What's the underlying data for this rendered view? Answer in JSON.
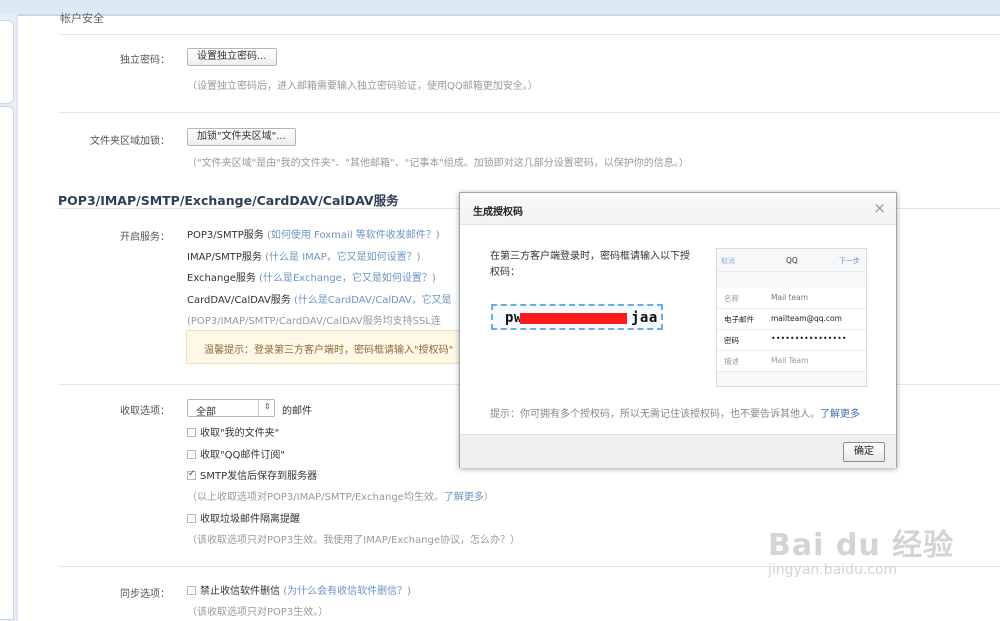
{
  "page": {
    "partial_heading": "帐户安全"
  },
  "independent_password": {
    "label": "独立密码：",
    "button": "设置独立密码...",
    "note": "（设置独立密码后，进入邮箱需要输入独立密码验证，使用QQ邮箱更加安全。）"
  },
  "folder_lock": {
    "label": "文件夹区域加锁：",
    "button": "加锁\"文件夹区域\"...",
    "note": "（\"文件夹区域\"是由\"我的文件夹\"、\"其他邮箱\"、\"记事本\"组成。加锁即对这几部分设置密码，以保护你的信息。）"
  },
  "services": {
    "section_title": "POP3/IMAP/SMTP/Exchange/CardDAV/CalDAV服务",
    "label": "开启服务：",
    "rows": [
      {
        "name": "POP3/SMTP服务",
        "link": "(如何使用 Foxmail 等软件收发邮件？)"
      },
      {
        "name": "IMAP/SMTP服务",
        "link": "(什么是 IMAP，它又是如何设置？)"
      },
      {
        "name": "Exchange服务",
        "link": "(什么是Exchange，它又是如何设置？)"
      },
      {
        "name": "CardDAV/CalDAV服务",
        "link": "(什么是CardDAV/CalDAV，它又是"
      }
    ],
    "ssl_note": "(POP3/IMAP/SMTP/CardDAV/CalDAV服务均支持SSL连",
    "tip": "温馨提示：登录第三方客户端时，密码框请输入\"授权码\""
  },
  "receive_options": {
    "label": "收取选项：",
    "select_value": "全部",
    "select_suffix": "的邮件",
    "options": [
      {
        "label": "收取\"我的文件夹\"",
        "checked": false
      },
      {
        "label": "收取\"QQ邮件订阅\"",
        "checked": false
      },
      {
        "label": "SMTP发信后保存到服务器",
        "checked": true
      }
    ],
    "note1": "（以上收取选项对POP3/IMAP/SMTP/Exchange均生效。",
    "note1_link": "了解更多",
    "note1_end": "）",
    "spam_option": "收取垃圾邮件隔离提醒",
    "note2": "（该收取选项只对POP3生效。我使用了IMAP/Exchange协议，怎么办？）"
  },
  "sync_options": {
    "label": "同步选项：",
    "option": "禁止收信软件删信",
    "option_link": "(为什么会有收信软件删信？)",
    "note": "（该收取选项只对POP3生效。）"
  },
  "dialog": {
    "title": "生成授权码",
    "close": "×",
    "instruction": "在第三方客户端登录时，密码框请输入以下授权码：",
    "code_start": "pw",
    "code_end": "jaa",
    "phone": {
      "cancel": "取消",
      "center": "QQ",
      "next": "下一步",
      "rows": [
        {
          "key": "名称",
          "value": "Mail team"
        },
        {
          "key": "电子邮件",
          "value": "mailteam@qq.com"
        },
        {
          "key": "密码",
          "value": "••••••••••••••••"
        },
        {
          "key": "描述",
          "value": "Mail Team"
        }
      ]
    },
    "hint": "提示：你可拥有多个授权码，所以无需记住该授权码，也不要告诉其他人。",
    "hint_link": "了解更多",
    "ok_button": "确定"
  },
  "watermark": {
    "brand": "Bai du 经验",
    "url": "jingyan.baidu.com"
  }
}
